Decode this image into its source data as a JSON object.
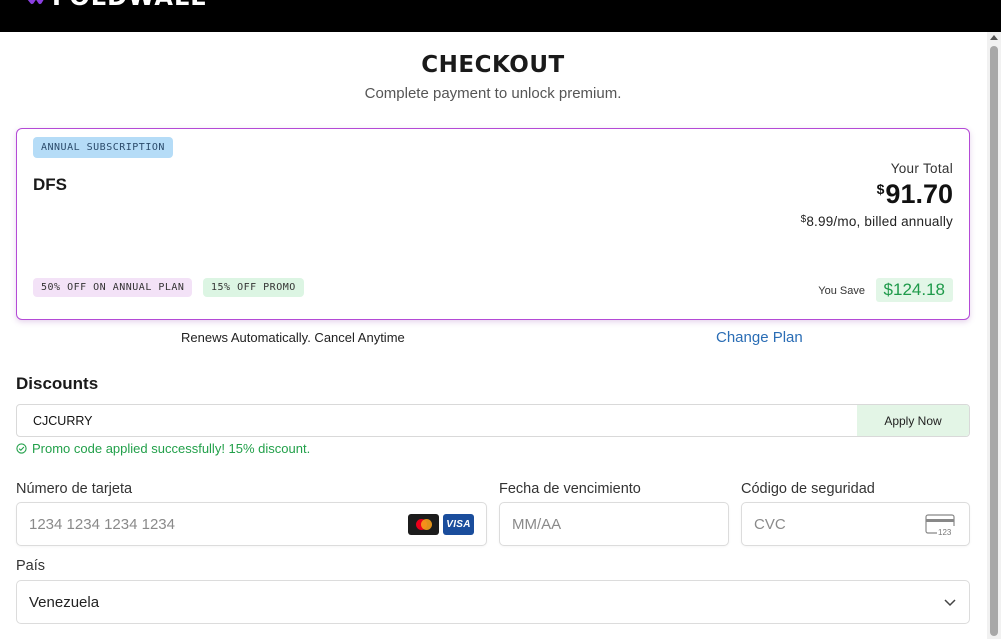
{
  "header": {
    "logo_text": "FOLDWALL"
  },
  "page": {
    "title": "CHECKOUT",
    "subtitle": "Complete payment to unlock premium."
  },
  "plan": {
    "badge": "ANNUAL SUBSCRIPTION",
    "name": "DFS",
    "total_label": "Your Total",
    "total_currency": "$",
    "total_amount": "91.70",
    "monthly_currency": "$",
    "monthly_text": "8.99/mo, billed annually",
    "discount_badges": [
      "50% OFF ON ANNUAL PLAN",
      "15% OFF PROMO"
    ],
    "you_save_label": "You Save",
    "you_save_value": "$124.18"
  },
  "renews_text": "Renews Automatically. Cancel Anytime",
  "change_plan_label": "Change Plan",
  "discounts": {
    "heading": "Discounts",
    "code_value": "CJCURRY",
    "apply_label": "Apply Now",
    "success_message": "Promo code applied successfully! 15% discount."
  },
  "payment": {
    "card_number_label": "Número de tarjeta",
    "card_number_placeholder": "1234 1234 1234 1234",
    "expiry_label": "Fecha de vencimiento",
    "expiry_placeholder": "MM/AA",
    "cvc_label": "Código de seguridad",
    "cvc_placeholder": "CVC",
    "cvc_icon_text": "123",
    "visa_text": "VISA",
    "country_label": "País",
    "country_value": "Venezuela"
  },
  "colors": {
    "accent_purple": "#b44ad6",
    "link_blue": "#2a6db5",
    "success_green": "#22a04a"
  },
  "icons": [
    "logo-icon",
    "mastercard-icon",
    "visa-icon",
    "cvc-card-icon",
    "check-circle-icon",
    "chevron-down-icon"
  ]
}
